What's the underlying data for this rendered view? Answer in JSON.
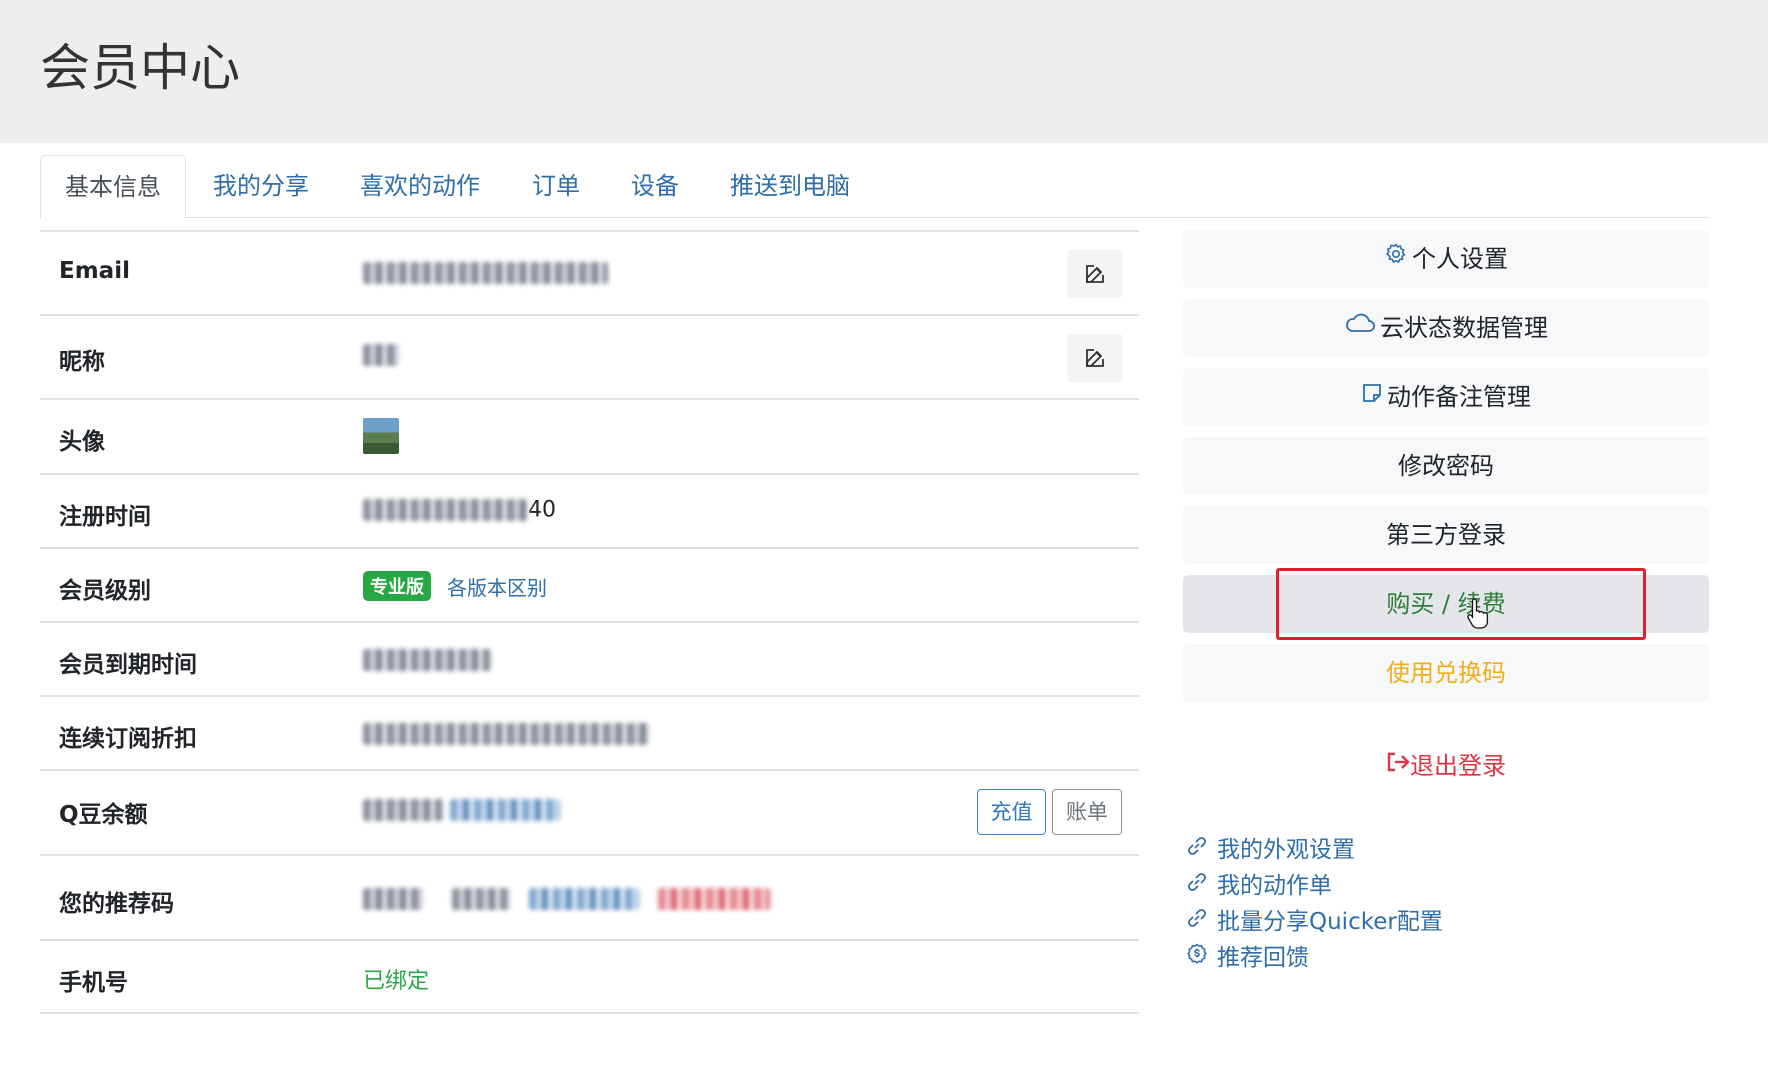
{
  "page": {
    "title": "会员中心"
  },
  "tabs": [
    {
      "label": "基本信息",
      "active": true
    },
    {
      "label": "我的分享"
    },
    {
      "label": "喜欢的动作"
    },
    {
      "label": "订单"
    },
    {
      "label": "设备"
    },
    {
      "label": "推送到电脑"
    }
  ],
  "info": {
    "email_label": "Email",
    "nickname_label": "昵称",
    "avatar_label": "头像",
    "registered_label": "注册时间",
    "registered_suffix": "40",
    "level_label": "会员级别",
    "level_badge": "专业版",
    "level_compare_link": "各版本区别",
    "expire_label": "会员到期时间",
    "discount_label": "连续订阅折扣",
    "balance_label": "Q豆余额",
    "recharge_button": "充值",
    "bill_button": "账单",
    "referral_label": "您的推荐码",
    "phone_label": "手机号",
    "phone_value": "已绑定"
  },
  "sidebar": {
    "personal_settings": "个人设置",
    "cloud_data": "云状态数据管理",
    "action_notes": "动作备注管理",
    "change_password": "修改密码",
    "third_party_login": "第三方登录",
    "buy_renew": "购买 / 续费",
    "redeem_code": "使用兑换码",
    "logout": "退出登录"
  },
  "links": {
    "appearance": "我的外观设置",
    "action_list": "我的动作单",
    "batch_share": "批量分享Quicker配置",
    "referral_reward": "推荐回馈"
  },
  "colors": {
    "link": "#2f6ea8",
    "success": "#28a745",
    "danger": "#dc3545",
    "warning": "#f0ad1c",
    "highlight": "#e0202a"
  }
}
